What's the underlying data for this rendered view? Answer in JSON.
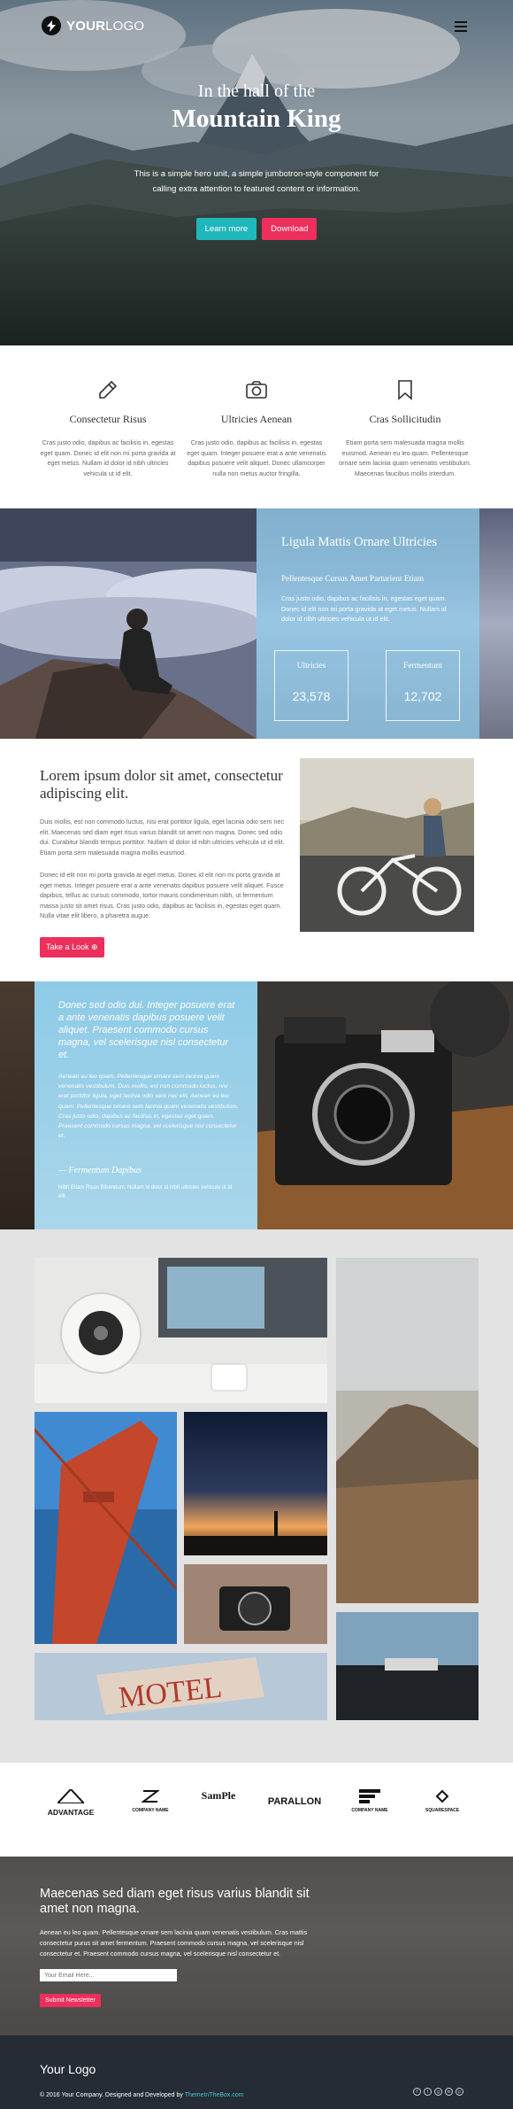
{
  "colors": {
    "accent_teal": "#1fb7b9",
    "accent_pink": "#ec2f5b",
    "panel_blue": "#8dc5e3",
    "footer_bg": "#252c35"
  },
  "header": {
    "logo_strong": "YOUR",
    "logo_rest": "LOGO",
    "menu_icon": "hamburger-icon"
  },
  "hero": {
    "subtitle": "In the hall of the",
    "title": "Mountain King",
    "text": "This is a simple hero unit, a simple jumbotron-style component for calling extra attention to featured content or information.",
    "button_primary": "Learn more",
    "button_secondary": "Download"
  },
  "features": [
    {
      "icon": "pencil-icon",
      "title": "Consectetur Risus",
      "text": "Cras justo odio, dapibus ac facilisis in, egestas eget quam. Donec id elit non mi porta gravida at eget metus. Nullam id dolor id nibh ultricies vehicula ut id elit."
    },
    {
      "icon": "camera-icon",
      "title": "Ultricies Aenean",
      "text": "Cras justo odio, dapibus ac facilisis in, egestas eget quam. Integer posuere erat a ante venenatis dapibus posuere velit aliquet. Donec ullamcorper nulla non metus auctor fringilla."
    },
    {
      "icon": "bookmark-icon",
      "title": "Cras Sollicitudin",
      "text": "Etiam porta sem malesuada magna mollis euismod. Aenean eu leo quam. Pellentesque ornare sem lacinia quam venenatis vestibulum. Maecenas faucibus mollis interdum."
    }
  ],
  "clouds": {
    "title": "Ligula Mattis Ornare Ultricies",
    "subtitle": "Pellentesque Cursus Amet Parturient Etiam",
    "text": "Cras justo odio, dapibus ac facilisis in, egestas eget quam. Donec id elit non mi porta gravida at eget metus. Nullam id dolor id nibh ultricies vehicula ut id elit.",
    "stats": [
      {
        "label": "Ultricies",
        "value": "23,578"
      },
      {
        "label": "Fermentum",
        "value": "12,702"
      }
    ]
  },
  "lorem": {
    "title": "Lorem ipsum dolor sit amet, consectetur adipiscing elit.",
    "p1": "Duis mollis, est non commodo luctus, nisi erat porttitor ligula, eget lacinia odio sem nec elit. Maecenas sed diam eget risus varius blandit sit amet non magna. Donec sed odio dui. Curabitur blandit tempus porttitor. Nullam id dolor id nibh ultricies vehicula ut id elit. Etiam porta sem malesuada magna mollis euismod.",
    "p2": "Donec id elit non mi porta gravida at eget metus. Donec id elit non mi porta gravida at eget metus. Integer posuere erat a ante venenatis dapibus posuere velit aliquet. Fusce dapibus, tellus ac cursus commodo, tortor mauris condimentum nibh, ut fermentum massa justo sit amet risus. Cras justo odio, dapibus ac facilisis in, egestas eget quam. Nulla vitae elit libero, a pharetra augue.",
    "button": "Take a Look ⊕"
  },
  "quote": {
    "text": "Donec sed odio dui. Integer posuere erat a ante venenatis dapibus posuere velit aliquet. Praesent commodo cursus magna, vel scelerisque nisl consectetur et.",
    "body": "Aenean eu leo quam. Pellentesque ornare sem lacinia quam venenatis vestibulum. Duis mollis, est non commodo luctus, nisi erat porttitor ligula, eget lacinia odio sem nec elit. Aenean eu leo quam. Pellentesque ornare sem lacinia quam venenatis vestibulum. Cras justo odio, dapibus ac facilisis in, egestas eget quam. Praesent commodo cursus magna, vel scelerisque nisl consectetur et.",
    "author": "— Fermentum Dapibus",
    "small": "Nibh Etiam Risus Bibendum. Nullam id dolor id nibh ultricies vehicula ut id elit."
  },
  "brands": [
    "ADVANTAGE",
    "COMPANY NAME",
    "SamPle",
    "PARALLON",
    "COMPANY NAME",
    "SQUARESPACE"
  ],
  "newsletter": {
    "title": "Maecenas sed diam eget risus varius blandit sit amet non magna.",
    "text": "Aenean eu leo quam. Pellentesque ornare sem lacinia quam venenatis vestibulum. Cras mattis consectetur purus sit amet fermentum. Praesent commodo cursus magna, vel scelerisque nisl consectetur et. Praesent commodo cursus magna, vel scelerisque nisl consectetur et.",
    "placeholder": "Your Email Here...",
    "button": "Submit Newsletter"
  },
  "footer": {
    "logo": "Your Logo",
    "copy": "© 2016 Your Company. Designed and Developed by ",
    "link": "ThemeInTheBox.com",
    "socials": [
      "f",
      "t",
      "g",
      "in",
      "p"
    ]
  }
}
